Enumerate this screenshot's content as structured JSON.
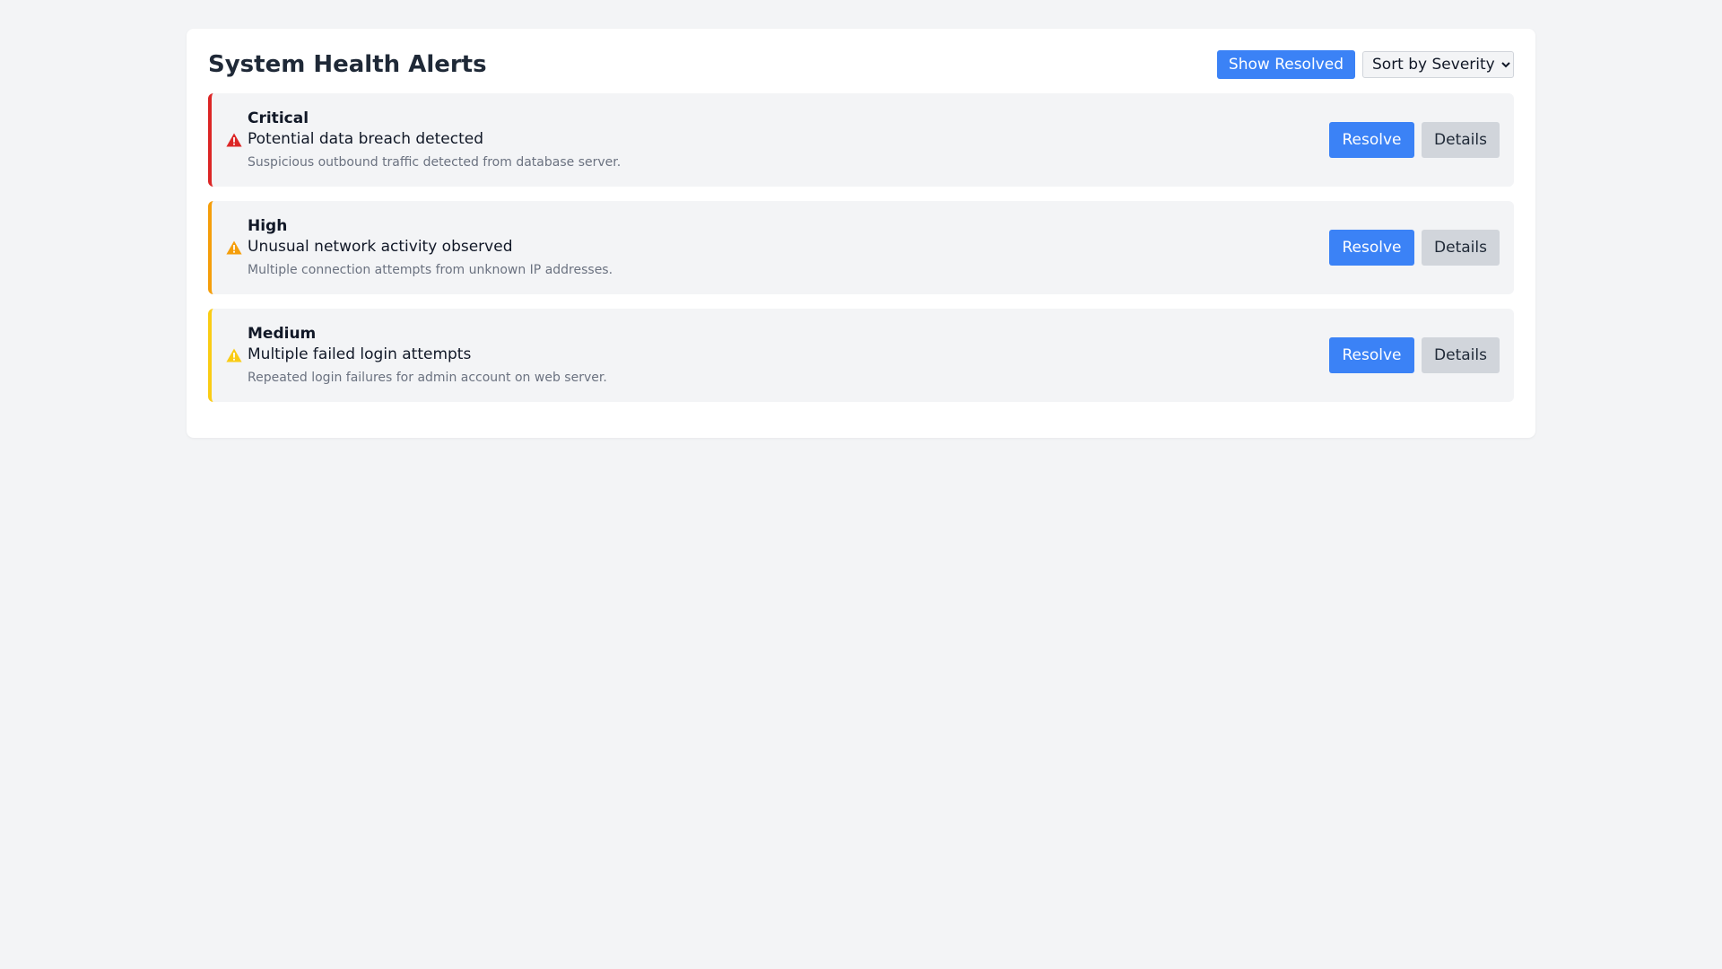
{
  "header": {
    "title": "System Health Alerts",
    "show_resolved_label": "Show Resolved",
    "sort": {
      "selected": "Sort by Severity",
      "options": [
        "Sort by Severity"
      ]
    }
  },
  "colors": {
    "accent": "#3b82f6",
    "critical": "#dc2626",
    "high": "#f59e0b",
    "medium": "#facc15"
  },
  "alerts": [
    {
      "severity": "Critical",
      "title": "Potential data breach detected",
      "description": "Suspicious outbound traffic detected from database server.",
      "icon": "warning-triangle-icon",
      "resolve_label": "Resolve",
      "details_label": "Details"
    },
    {
      "severity": "High",
      "title": "Unusual network activity observed",
      "description": "Multiple connection attempts from unknown IP addresses.",
      "icon": "warning-triangle-icon",
      "resolve_label": "Resolve",
      "details_label": "Details"
    },
    {
      "severity": "Medium",
      "title": "Multiple failed login attempts",
      "description": "Repeated login failures for admin account on web server.",
      "icon": "warning-triangle-icon",
      "resolve_label": "Resolve",
      "details_label": "Details"
    }
  ]
}
